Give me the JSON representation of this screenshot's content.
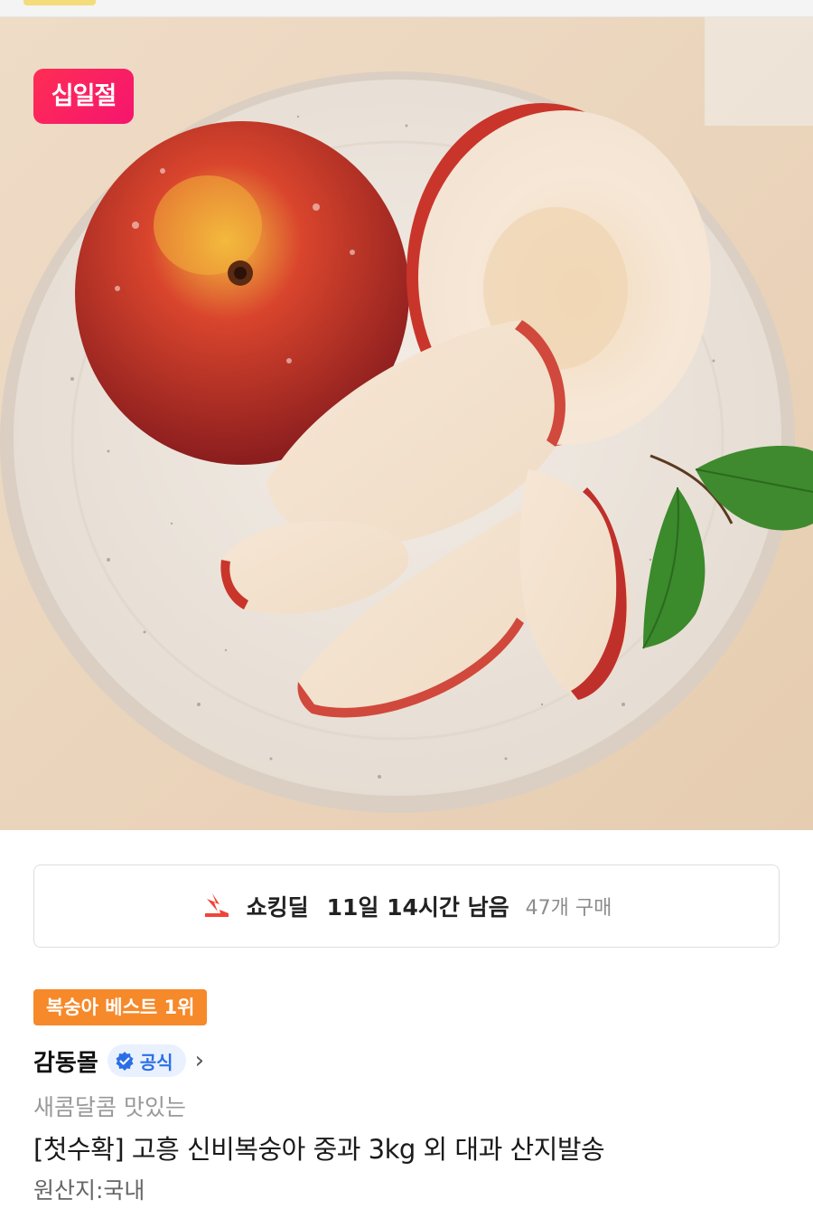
{
  "promo_badge": "십일절",
  "deal": {
    "icon": "shocking-deal-icon",
    "title": "쇼킹딜",
    "time_left": "11일 14시간 남음",
    "purchase_count": "47개 구매"
  },
  "rank_badge": "복숭아 베스트 1위",
  "seller": {
    "name": "감동몰",
    "official_label": "공식",
    "verified_icon": "verified-check-icon",
    "chevron": "›"
  },
  "product": {
    "subtitle": "새콤달콤 맛있는",
    "title": "[첫수확] 고흥 신비복숭아 중과 3kg 외 대과 산지발송",
    "origin": "원산지:국내"
  },
  "colors": {
    "promo": "#ff2d55",
    "rank_badge": "#f6892a",
    "official_text": "#2b6fe6",
    "official_bg": "#e9f1ff"
  }
}
